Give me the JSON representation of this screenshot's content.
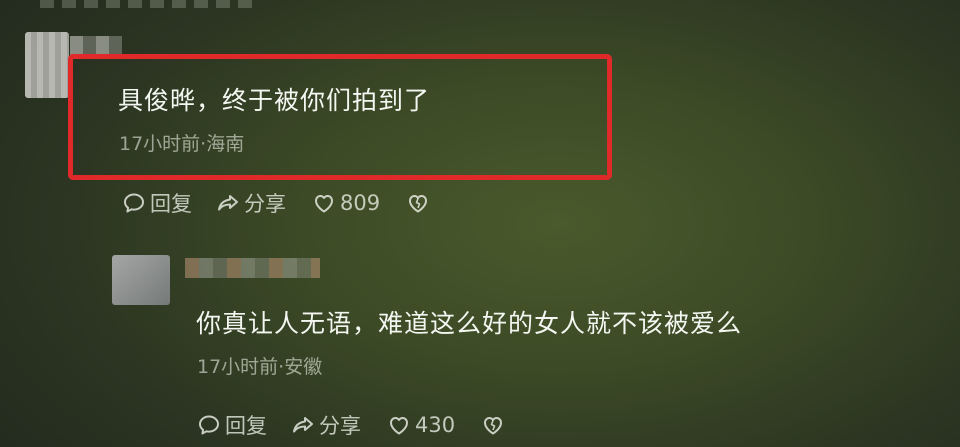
{
  "thread": {
    "comment1": {
      "text": "具俊晔，终于被你们拍到了",
      "meta": "17小时前·海南",
      "actions": {
        "reply_label": "回复",
        "share_label": "分享",
        "like_count": "809"
      }
    },
    "comment2": {
      "text": "你真让人无语，难道这么好的女人就不该被爱么",
      "meta": "17小时前·安徽",
      "actions": {
        "reply_label": "回复",
        "share_label": "分享",
        "like_count": "430"
      }
    }
  },
  "colors": {
    "highlight_border": "#e02a2a",
    "background": "#3c4a26",
    "text": "#f4f6f1"
  },
  "icons": {
    "reply": "comment-bubble-icon",
    "share": "share-arrow-icon",
    "like": "heart-icon",
    "dislike": "broken-heart-icon"
  }
}
